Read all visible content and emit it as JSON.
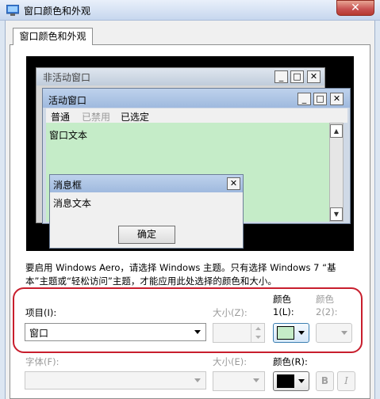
{
  "window": {
    "title": "窗口颜色和外观",
    "close_glyph": "✕"
  },
  "tab": {
    "label": "窗口颜色和外观"
  },
  "preview": {
    "inactive_title": "非活动窗口",
    "active_title": "活动窗口",
    "menu": {
      "normal": "普通",
      "disabled": "已禁用",
      "selected": "已选定"
    },
    "window_text": "窗口文本",
    "message_box_title": "消息框",
    "message_text": "消息文本",
    "ok_button": "确定",
    "win_buttons": {
      "minimize": "_",
      "maximize": "□",
      "close": "✕"
    },
    "scroll_up": "▲",
    "scroll_down": "▼"
  },
  "description": "要启用 Windows Aero，请选择 Windows 主题。只有选择 Windows 7 “基本”主题或“轻松访问”主题，才能应用此处选择的颜色和大小。",
  "item_row": {
    "item_label": "项目(I):",
    "item_value": "窗口",
    "size_label": "大小(Z):",
    "color1_label_top": "颜色",
    "color1_label_bottom": "1(L):",
    "color2_label_top": "颜色",
    "color2_label_bottom": "2(2):",
    "color1_value": "#c5ecc8"
  },
  "font_row": {
    "font_label": "字体(F):",
    "size_label": "大小(E):",
    "color_label": "颜色(R):",
    "color_value": "#000000",
    "bold": "B",
    "italic": "I"
  },
  "colors": {
    "highlight_border": "#c81e2d",
    "window_bg": "#c5ecc8"
  }
}
